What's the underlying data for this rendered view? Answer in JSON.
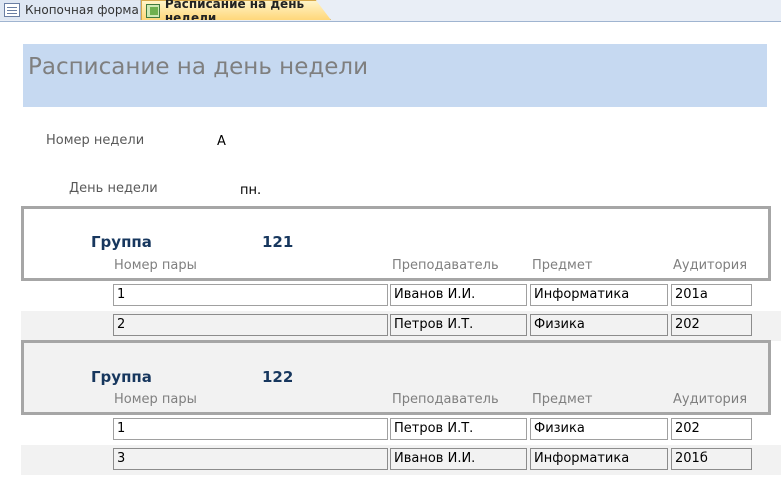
{
  "tabs": [
    {
      "label": "Кнопочная форма",
      "icon": "switchboard-form-icon"
    },
    {
      "label": "Расписание на день недели",
      "icon": "report-icon"
    }
  ],
  "report": {
    "title": "Расписание на день недели",
    "week_number_label": "Номер недели",
    "week_number_value": "А",
    "weekday_label": "День недели",
    "weekday_value": "пн."
  },
  "columns": {
    "pair_number": "Номер пары",
    "teacher": "Преподаватель",
    "subject": "Предмет",
    "room": "Аудитория"
  },
  "groups": [
    {
      "label": "Группа",
      "number": "121",
      "rows": [
        {
          "pair": "1",
          "teacher": "Иванов И.И.",
          "subject": "Информатика",
          "room": "201а"
        },
        {
          "pair": "2",
          "teacher": "Петров И.Т.",
          "subject": "Физика",
          "room": "202"
        }
      ]
    },
    {
      "label": "Группа",
      "number": "122",
      "rows": [
        {
          "pair": "1",
          "teacher": "Петров И.Т.",
          "subject": "Физика",
          "room": "202"
        },
        {
          "pair": "3",
          "teacher": "Иванов И.И.",
          "subject": "Информатика",
          "room": "201б"
        }
      ]
    }
  ]
}
